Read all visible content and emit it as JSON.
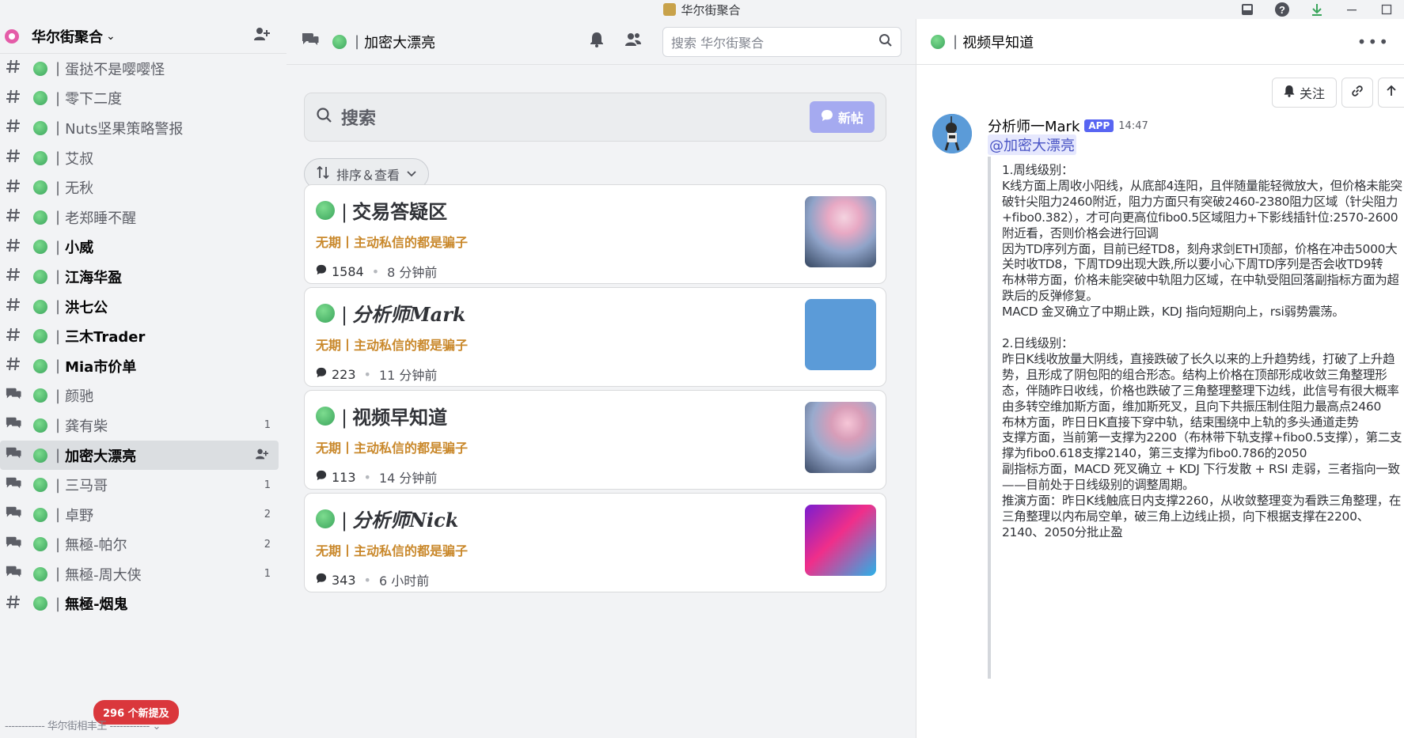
{
  "window": {
    "title": "华尔街聚合",
    "icons": [
      "inbox-icon",
      "help-icon",
      "download-icon",
      "minimize-icon",
      "maximize-icon"
    ]
  },
  "sidebar": {
    "server_name": "华尔街聚合",
    "channels": [
      {
        "type": "text",
        "name": "蛋挞不是嘤嘤怪",
        "bold": false,
        "badge": ""
      },
      {
        "type": "text",
        "name": "零下二度",
        "bold": false,
        "badge": ""
      },
      {
        "type": "text",
        "name": "Nuts坚果策略警报",
        "bold": false,
        "badge": ""
      },
      {
        "type": "text",
        "name": "艾叔",
        "bold": false,
        "badge": ""
      },
      {
        "type": "text",
        "name": "无秋",
        "bold": false,
        "badge": ""
      },
      {
        "type": "text",
        "name": "老郑睡不醒",
        "bold": false,
        "badge": ""
      },
      {
        "type": "text",
        "name": "小威",
        "bold": true,
        "badge": ""
      },
      {
        "type": "text",
        "name": "江海华盈",
        "bold": true,
        "badge": ""
      },
      {
        "type": "text",
        "name": "洪七公",
        "bold": true,
        "badge": ""
      },
      {
        "type": "text",
        "name": "三木Trader",
        "bold": true,
        "badge": ""
      },
      {
        "type": "text",
        "name": "Mia市价单",
        "bold": true,
        "badge": ""
      },
      {
        "type": "forum",
        "name": "颜驰",
        "bold": false,
        "badge": ""
      },
      {
        "type": "forum",
        "name": "龚有柴",
        "bold": false,
        "badge": "1"
      },
      {
        "type": "forum",
        "name": "加密大漂亮",
        "bold": true,
        "badge": "",
        "active": true
      },
      {
        "type": "forum",
        "name": "三马哥",
        "bold": false,
        "badge": "1"
      },
      {
        "type": "forum",
        "name": "卓野",
        "bold": false,
        "badge": "2"
      },
      {
        "type": "forum",
        "name": "無極-帕尔",
        "bold": false,
        "badge": "2"
      },
      {
        "type": "forum",
        "name": "無極-周大侠",
        "bold": false,
        "badge": "1"
      },
      {
        "type": "text",
        "name": "無極-烟鬼",
        "bold": true,
        "badge": ""
      }
    ],
    "new_mentions": "296 个新提及",
    "footer": "------------ 华尔街相丰王 ------------ ⌄"
  },
  "middle": {
    "channel_title": "加密大漂亮",
    "search_placeholder": "搜索 华尔街聚合",
    "forum_search_placeholder": "搜索",
    "new_post_label": "新帖",
    "sort_label": "排序＆查看",
    "posts": [
      {
        "title": "交易答疑区",
        "subtitle": "无期丨主动私信的都是骗子",
        "count": "1584",
        "time": "8 分钟前"
      },
      {
        "title": "分析师Mark",
        "subtitle": "无期丨主动私信的都是骗子",
        "count": "223",
        "time": "11 分钟前"
      },
      {
        "title": "视频早知道",
        "subtitle": "无期丨主动私信的都是骗子",
        "count": "113",
        "time": "14 分钟前"
      },
      {
        "title": "分析师Nick",
        "subtitle": "无期丨主动私信的都是骗子",
        "count": "343",
        "time": "6 小时前"
      }
    ]
  },
  "right": {
    "thread_title": "视频早知道",
    "follow_label": "关注",
    "message": {
      "author": "分析师一Mark",
      "tag": "APP",
      "time": "14:47",
      "mention": "@加密大漂亮",
      "body": "1.周线级别：\nK线方面上周收小阳线，从底部4连阳，且伴随量能轻微放大，但价格未能突破针尖阻力2460附近，阻力方面只有突破2460-2380阻力区域（针尖阻力+fibo0.382），才可向更高位fibo0.5区域阻力+下影线插针位:2570-2600附近看，否则价格会进行回调\n因为TD序列方面，目前已经TD8，刻舟求剑ETH顶部，价格在冲击5000大关时收TD8，下周TD9出现大跌,所以要小心下周TD序列是否会收TD9转\n布林带方面，价格未能突破中轨阻力区域，在中轨受阻回落副指标方面为超跌后的反弹修复。\nMACD 金叉确立了中期止跌，KDJ 指向短期向上，rsi弱势震荡。\n\n2.日线级别：\n昨日K线收放量大阴线，直接跌破了长久以来的上升趋势线，打破了上升趋势，且形成了阴包阳的组合形态。结构上价格在顶部形成收敛三角整理形态，伴随昨日收线，价格也跌破了三角整理整理下边线，此信号有很大概率由多转空维加斯方面，维加斯死叉，且向下共振压制住阻力最高点2460\n布林方面，昨日日K直接下穿中轨，结束围绕中上轨的多头通道走势\n支撑方面，当前第一支撑为2200（布林带下轨支撑+fibo0.5支撑），第二支撑为fibo0.618支撑2140，第三支撑为fibo0.786的2050\n副指标方面，MACD 死叉确立 + KDJ 下行发散 + RSI 走弱，三者指向一致——目前处于日线级别的调整周期。\n推演方面：昨日K线触底日内支撑2260，从收敛整理变为看跌三角整理，在三角整理以内布局空单，破三角上边线止损，向下根据支撑在2200、2140、2050分批止盈"
    }
  }
}
